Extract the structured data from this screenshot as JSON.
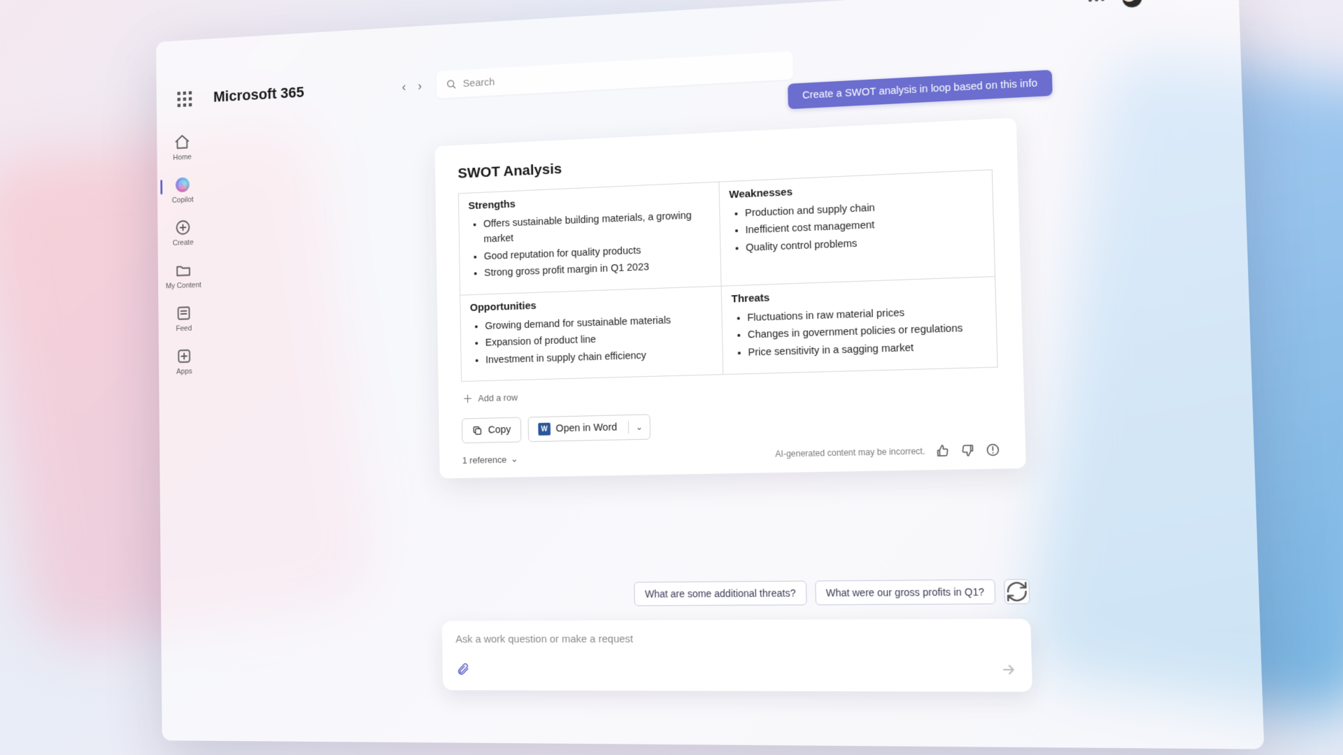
{
  "app": {
    "brand": "Microsoft 365"
  },
  "search": {
    "placeholder": "Search"
  },
  "rail": {
    "home": "Home",
    "copilot": "Copilot",
    "create": "Create",
    "mycontent": "My Content",
    "feed": "Feed",
    "apps": "Apps"
  },
  "chat": {
    "user_message": "Create a SWOT analysis in loop based on this info",
    "title": "SWOT Analysis",
    "quadrants": {
      "strengths": {
        "label": "Strengths",
        "items": [
          "Offers sustainable building materials, a growing market",
          "Good reputation for quality products",
          "Strong gross profit margin in Q1 2023"
        ]
      },
      "weaknesses": {
        "label": "Weaknesses",
        "items": [
          "Production and supply chain",
          "Inefficient cost management",
          "Quality control problems"
        ]
      },
      "opportunities": {
        "label": "Opportunities",
        "items": [
          "Growing demand for sustainable materials",
          "Expansion of product line",
          "Investment in supply chain efficiency"
        ]
      },
      "threats": {
        "label": "Threats",
        "items": [
          "Fluctuations in raw material prices",
          "Changes in government policies or regulations",
          "Price sensitivity in a sagging market"
        ]
      }
    },
    "add_row": "Add a row",
    "copy": "Copy",
    "open_in_word": "Open in Word",
    "references": "1 reference",
    "disclaimer": "AI-generated content may be incorrect.",
    "suggestions": [
      "What are some additional threats?",
      "What were our gross profits in Q1?"
    ],
    "input_placeholder": "Ask a work question or make a request"
  }
}
